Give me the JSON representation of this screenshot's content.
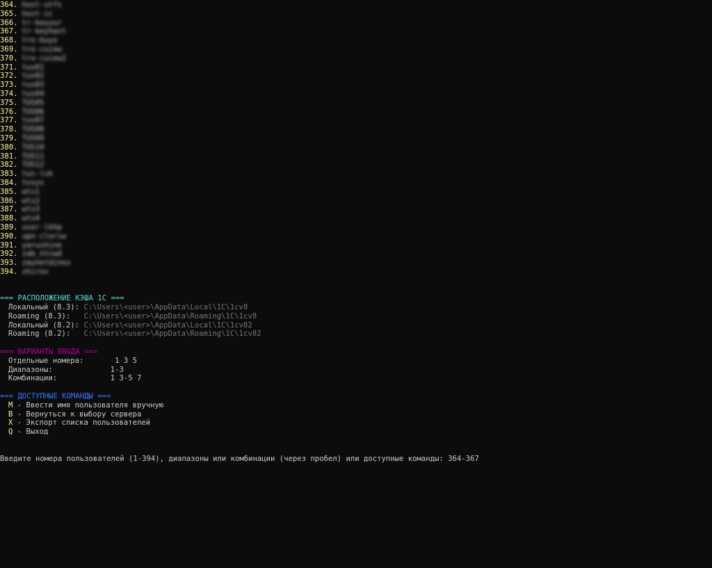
{
  "users": [
    {
      "num": "364.",
      "name": "host-utfs"
    },
    {
      "num": "365.",
      "name": "host-ic"
    },
    {
      "num": "366.",
      "name": "tr-keyyur"
    },
    {
      "num": "367.",
      "name": "tr-keyhast"
    },
    {
      "num": "368.",
      "name": "tro-buyo"
    },
    {
      "num": "369.",
      "name": "tro-cuiew"
    },
    {
      "num": "370.",
      "name": "tro-cuiew2"
    },
    {
      "num": "371.",
      "name": "tus01"
    },
    {
      "num": "372.",
      "name": "tus02"
    },
    {
      "num": "373.",
      "name": "tus03"
    },
    {
      "num": "374.",
      "name": "tus04"
    },
    {
      "num": "375.",
      "name": "TUS05"
    },
    {
      "num": "376.",
      "name": "TUS06"
    },
    {
      "num": "377.",
      "name": "tus07"
    },
    {
      "num": "378.",
      "name": "TUS08"
    },
    {
      "num": "379.",
      "name": "TUS09"
    },
    {
      "num": "380.",
      "name": "TUS10"
    },
    {
      "num": "381.",
      "name": "TUS11"
    },
    {
      "num": "382.",
      "name": "TUS12"
    },
    {
      "num": "383.",
      "name": "tus-lsk"
    },
    {
      "num": "384.",
      "name": "tvsys"
    },
    {
      "num": "385.",
      "name": "wts1"
    },
    {
      "num": "386.",
      "name": "wts2"
    },
    {
      "num": "387.",
      "name": "wts3"
    },
    {
      "num": "388.",
      "name": "wts4"
    },
    {
      "num": "389.",
      "name": "user-lkhp"
    },
    {
      "num": "390.",
      "name": "upn-cloriw"
    },
    {
      "num": "391.",
      "name": "yarushine"
    },
    {
      "num": "392.",
      "name": "zab_ntcwd"
    },
    {
      "num": "393.",
      "name": "zaynetdinov"
    },
    {
      "num": "394.",
      "name": "zhirov"
    }
  ],
  "cache": {
    "header": "=== РАСПОЛОЖЕНИЕ КЭША 1С ===",
    "rows": [
      {
        "label": "Локальный (8.3):",
        "path": "C:\\Users\\<user>\\AppData\\Local\\1C\\1cv8"
      },
      {
        "label": "Roaming (8.3):  ",
        "path": "C:\\Users\\<user>\\AppData\\Roaming\\1C\\1cv8"
      },
      {
        "label": "Локальный (8.2):",
        "path": "C:\\Users\\<user>\\AppData\\Local\\1C\\1cv82"
      },
      {
        "label": "Roaming (8.2):  ",
        "path": "C:\\Users\\<user>\\AppData\\Roaming\\1C\\1cv82"
      }
    ]
  },
  "input_options": {
    "header": "=== ВАРИАНТЫ ВВОДА ===",
    "rows": [
      {
        "label": "Отдельные номера:",
        "value": "  1 3 5"
      },
      {
        "label": "Диапазоны:       ",
        "value": " 1-3"
      },
      {
        "label": "Комбинации:      ",
        "value": " 1 3-5 7"
      }
    ]
  },
  "commands": {
    "header": "=== ДОСТУПНЫЕ КОМАНДЫ ===",
    "rows": [
      {
        "key": "M",
        "desc": " - Ввести имя пользователя вручную"
      },
      {
        "key": "B",
        "desc": " - Вернуться к выбору сервера"
      },
      {
        "key": "X",
        "desc": " - Экспорт списка пользователей"
      },
      {
        "key": "Q",
        "desc": " - Выход"
      }
    ]
  },
  "prompt": {
    "text": "Введите номера пользователей (1-394), диапазоны или комбинации (через пробел) или доступные команды: ",
    "input": "364-367"
  },
  "colors": {
    "background": "#0c0c0c",
    "number": "#f9f1a5",
    "cache_header": "#61d6d6",
    "input_header": "#b4009e",
    "commands_header": "#3b78ff",
    "path": "#767676"
  }
}
